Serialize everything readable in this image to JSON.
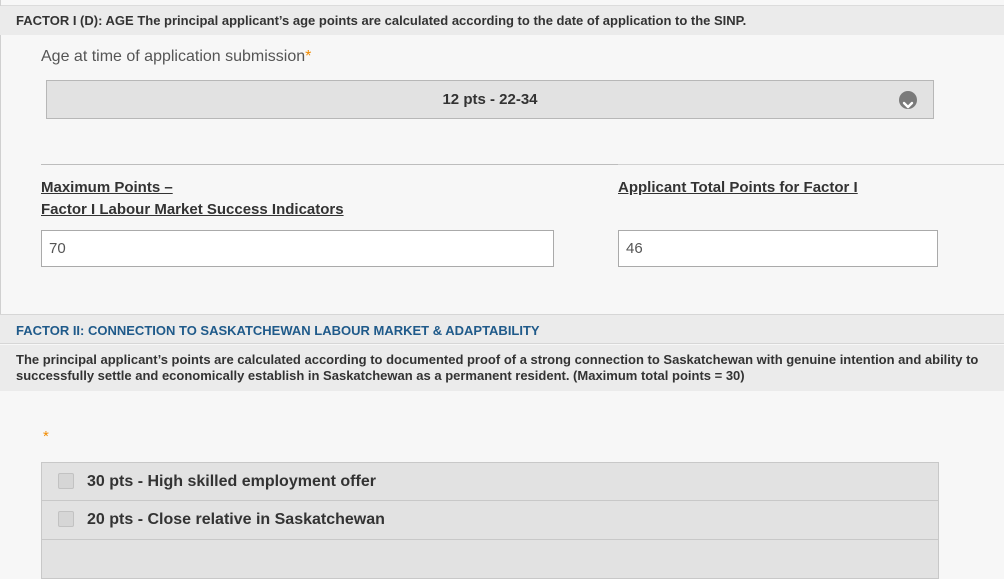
{
  "factor1d": {
    "heading": "FACTOR I (D): AGE The principal applicant’s age points are calculated according to the date of application to the SINP.",
    "age_label": "Age at time of application submission",
    "required_marker": "*",
    "age_selected": "12 pts - 22-34",
    "dropdown_icon": "chevron-down-circle-icon"
  },
  "totals": {
    "max_label_line1": "Maximum Points – ",
    "max_label_line2": "Factor I Labour Market Success Indicators",
    "max_value": "70",
    "applicant_label": "Applicant Total Points for Factor I",
    "applicant_value": "46"
  },
  "factor2": {
    "heading": "FACTOR II: CONNECTION TO SASKATCHEWAN LABOUR MARKET & ADAPTABILITY",
    "heading_color": "#1f5a8a",
    "description": "The principal applicant’s points are calculated according to documented proof of a strong connection to Saskatchewan with genuine intention and ability to successfully settle and economically establish in Saskatchewan as a permanent resident. (Maximum total points = 30)",
    "required_marker": "*",
    "options": [
      {
        "label": "30 pts - High skilled employment offer",
        "checked": false
      },
      {
        "label": "20 pts - Close relative in Saskatchewan",
        "checked": false
      }
    ]
  },
  "colors": {
    "required": "#f28b00",
    "band": "#ebebeb",
    "panel": "#e2e2e2"
  }
}
